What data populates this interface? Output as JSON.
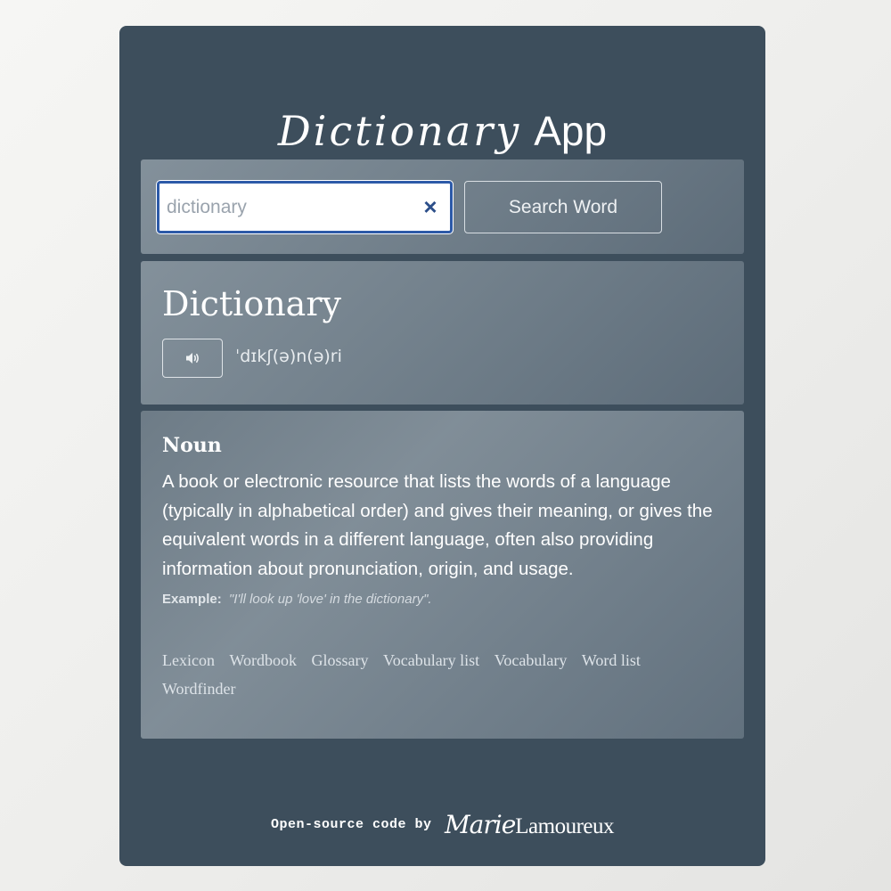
{
  "header": {
    "title_script": "Dictionary",
    "title_plain": "App"
  },
  "search": {
    "value": "dictionary",
    "clear_icon": "×",
    "button_label": "Search Word"
  },
  "word": {
    "headword": "Dictionary",
    "audio_icon": "speaker-icon",
    "phonetic": "ˈdɪkʃ(ə)n(ə)ri"
  },
  "meaning": {
    "part_of_speech": "Noun",
    "definition": "A book or electronic resource that lists the words of a language (typically in alphabetical order) and gives their meaning, or gives the equivalent words in a different language, often also providing information about pronunciation, origin, and usage.",
    "example_label": "Example:",
    "example_text": "\"I'll look up 'love' in the dictionary\".",
    "synonyms": [
      "Lexicon",
      "Wordbook",
      "Glossary",
      "Vocabulary list",
      "Vocabulary",
      "Word list",
      "Wordfinder"
    ]
  },
  "footer": {
    "text": "Open-source code by",
    "author_first": "Marie",
    "author_last": "Lamoureux"
  },
  "colors": {
    "app_background": "#3d4e5c",
    "input_border": "#2d5aa8",
    "text": "#ffffff"
  }
}
